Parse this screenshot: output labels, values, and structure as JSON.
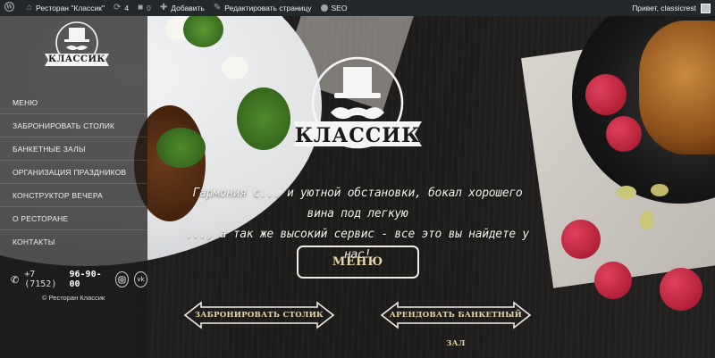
{
  "adminbar": {
    "wp_icon": "wordpress-icon",
    "site_title": "Ресторан \"Классик\"",
    "updates_count": "4",
    "comments_count": "0",
    "add_new": "Добавить",
    "edit_page": "Редактировать страницу",
    "seo": "SEO",
    "greeting": "Привет, classicrest"
  },
  "brand": {
    "logo_text": "КЛАССИК"
  },
  "sidebar": {
    "menu": [
      "МЕНЮ",
      "ЗАБРОНИРОВАТЬ СТОЛИК",
      "БАНКЕТНЫЕ ЗАЛЫ",
      "ОРГАНИЗАЦИЯ ПРАЗДНИКОВ",
      "КОНСТРУКТОР ВЕЧЕРА",
      "О РЕСТОРАНЕ",
      "КОНТАКТЫ"
    ],
    "phone_code": "+7 (7152)",
    "phone_number": "96-90-00",
    "social": [
      "instagram-icon",
      "vk-icon"
    ],
    "vk_label": "vk",
    "copyright": "© Ресторан Классик"
  },
  "hero": {
    "tagline_line1": "Гармония с... и уютной обстановки, бокал хорошего вина под легкую",
    "tagline_line2": "..., а так же высокий сервис - все это вы найдете у нас!",
    "menu_button": "МЕНЮ",
    "book_button": "ЗАБРОНИРОВАТЬ СТОЛИК",
    "rent_button": "АРЕНДОВАТЬ БАНКЕТНЫЙ ЗАЛ"
  },
  "colors": {
    "accent_gold": "#e9d7a4",
    "admin_bar": "#23282d"
  }
}
